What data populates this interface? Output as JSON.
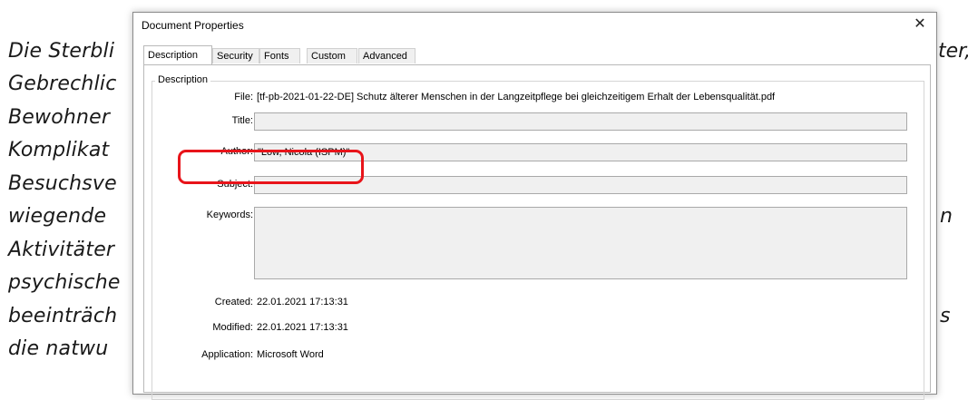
{
  "background_document": {
    "lines": [
      "Die Sterbli",
      "Gebrechlic",
      "Bewohner",
      "Komplikat",
      "Besuchsve",
      "wiegende",
      "Aktivitäter",
      "psychische",
      "beeinträch",
      "die natwu"
    ],
    "right_fragments": [
      "ter,",
      "n",
      "s"
    ]
  },
  "dialog": {
    "title": "Document Properties",
    "close_glyph": "✕",
    "tabs": [
      "Description",
      "Security",
      "Fonts",
      "Custom",
      "Advanced"
    ],
    "active_tab": "Description",
    "group_label": "Description",
    "labels": {
      "file": "File:",
      "title": "Title:",
      "author": "Author:",
      "subject": "Subject:",
      "keywords": "Keywords:",
      "created": "Created:",
      "modified": "Modified:",
      "application": "Application:"
    },
    "values": {
      "file": "[tf-pb-2021-01-22-DE] Schutz älterer Menschen in der Langzeitpflege bei gleichzeitigem Erhalt der Lebensqualität.pdf",
      "title": "",
      "author": "\"Low, Nicola (ISPM)\"",
      "subject": "",
      "keywords": "",
      "created": "22.01.2021 17:13:31",
      "modified": "22.01.2021 17:13:31",
      "application": "Microsoft Word"
    },
    "highlight_color": "#e8141a"
  }
}
